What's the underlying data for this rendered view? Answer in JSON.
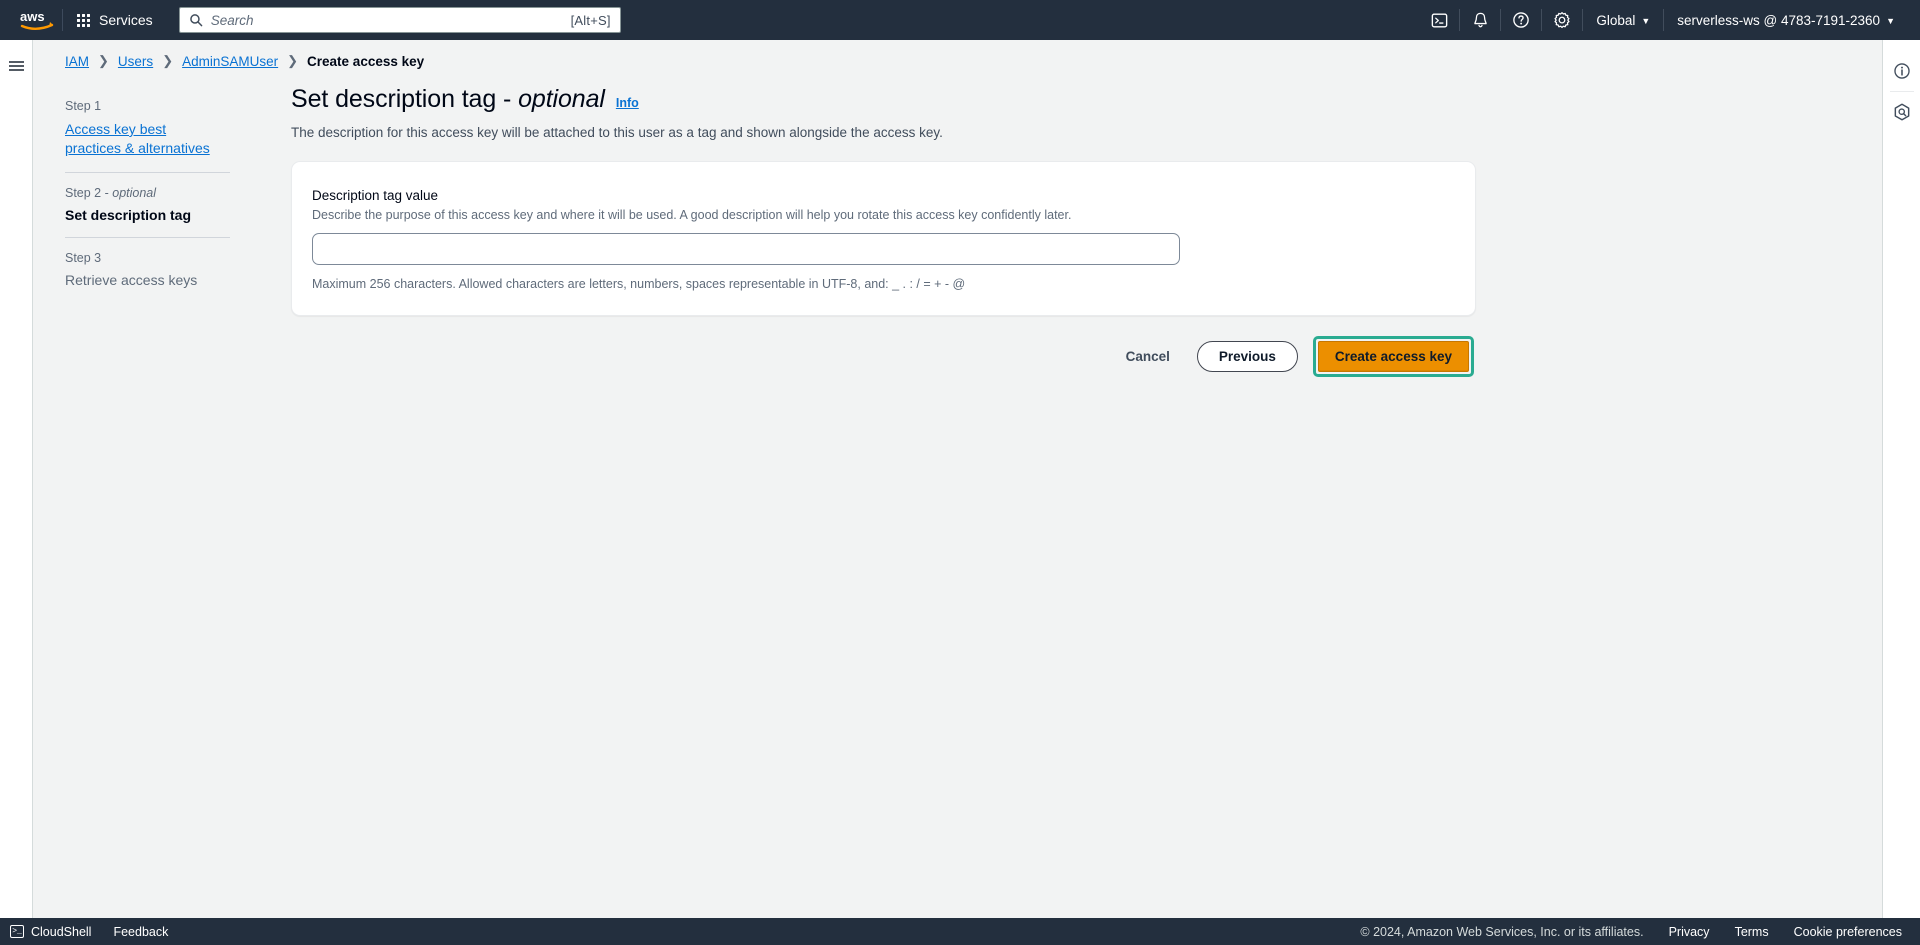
{
  "topnav": {
    "logo_alt": "aws",
    "services_label": "Services",
    "search_placeholder": "Search",
    "search_value": "",
    "search_shortcut": "[Alt+S]",
    "cloudshell_icon": "cloudshell-icon",
    "notifications_icon": "bell-icon",
    "help_icon": "question-circle-icon",
    "settings_icon": "gear-icon",
    "region_label": "Global",
    "account_label": "serverless-ws @ 4783-7191-2360",
    "caret": "▼"
  },
  "breadcrumb": {
    "items": [
      {
        "label": "IAM",
        "link": true
      },
      {
        "label": "Users",
        "link": true
      },
      {
        "label": "AdminSAMUser",
        "link": true
      },
      {
        "label": "Create access key",
        "link": false
      }
    ],
    "separator": "❯"
  },
  "steps": [
    {
      "step": "Step 1",
      "title": "Access key best practices & alternatives",
      "state": "link"
    },
    {
      "step": "Step 2 - ",
      "step_optional": "optional",
      "title": "Set description tag",
      "state": "active"
    },
    {
      "step": "Step 3",
      "title": "Retrieve access keys",
      "state": "muted"
    }
  ],
  "wizard": {
    "title": "Set description tag - ",
    "title_optional": "optional",
    "info_label": "Info",
    "description": "The description for this access key will be attached to this user as a tag and shown alongside the access key."
  },
  "form": {
    "field_label": "Description tag value",
    "field_description": "Describe the purpose of this access key and where it will be used. A good description will help you rotate this access key confidently later.",
    "input_value": "",
    "input_placeholder": "",
    "constraint": "Maximum 256 characters. Allowed characters are letters, numbers, spaces representable in UTF-8, and: _ . : / = + - @"
  },
  "actions": {
    "cancel_label": "Cancel",
    "previous_label": "Previous",
    "create_label": "Create access key",
    "highlight_color": "#2aab91",
    "primary_color": "#ec8f00"
  },
  "right_rail": {
    "info_panel_icon": "info-circle-icon",
    "assistant_icon": "hexagon-q-icon"
  },
  "footer": {
    "cloudshell_label": "CloudShell",
    "feedback_label": "Feedback",
    "copyright": "© 2024, Amazon Web Services, Inc. or its affiliates.",
    "privacy_label": "Privacy",
    "terms_label": "Terms",
    "cookie_label": "Cookie preferences"
  }
}
